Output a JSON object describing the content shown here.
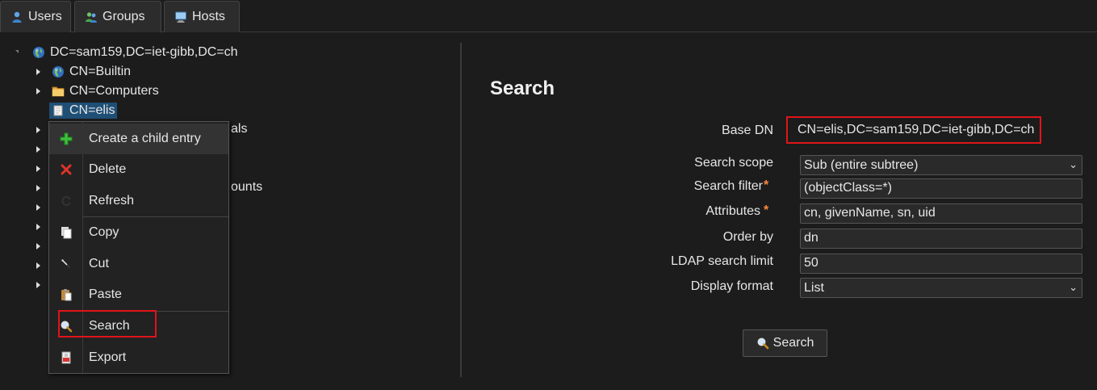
{
  "tabs": [
    {
      "label": "Users",
      "icon": "user-icon"
    },
    {
      "label": "Groups",
      "icon": "groups-icon"
    },
    {
      "label": "Hosts",
      "icon": "hosts-icon"
    }
  ],
  "tree": {
    "root": {
      "label": "DC=sam159,DC=iet-gibb,DC=ch",
      "icon": "globe-icon"
    },
    "children": [
      {
        "label": "CN=Builtin",
        "icon": "globe-icon"
      },
      {
        "label": "CN=Computers",
        "icon": "folder-icon"
      },
      {
        "label": "CN=elis",
        "icon": "entry-icon",
        "selected": true
      }
    ],
    "partially_hidden": [
      {
        "text": "als"
      },
      {
        "text": "ounts"
      }
    ]
  },
  "context_menu": {
    "items": [
      {
        "label": "Create a child entry",
        "icon": "plus-icon"
      },
      {
        "label": "Delete",
        "icon": "delete-icon"
      },
      {
        "label": "Refresh",
        "icon": "refresh-icon"
      },
      {
        "label": "Copy",
        "icon": "copy-icon"
      },
      {
        "label": "Cut",
        "icon": "cut-icon"
      },
      {
        "label": "Paste",
        "icon": "paste-icon"
      },
      {
        "label": "Search",
        "icon": "search-icon"
      },
      {
        "label": "Export",
        "icon": "export-icon"
      }
    ]
  },
  "search_panel": {
    "title": "Search",
    "base_dn_label": "Base DN",
    "base_dn_value": "CN=elis,DC=sam159,DC=iet-gibb,DC=ch",
    "scope_label": "Search scope",
    "scope_value": "Sub (entire subtree)",
    "filter_label": "Search filter",
    "filter_value": "(objectClass=*)",
    "attributes_label": "Attributes",
    "attributes_value": "cn, givenName, sn, uid",
    "order_label": "Order by",
    "order_value": "dn",
    "limit_label": "LDAP search limit",
    "limit_value": "50",
    "format_label": "Display format",
    "format_value": "List",
    "required_mark": "*",
    "button_label": "Search"
  },
  "colors": {
    "background": "#1c1c1c",
    "selection": "#1f4f75",
    "highlight_border": "#e0141a",
    "required": "#ff8a3d"
  }
}
